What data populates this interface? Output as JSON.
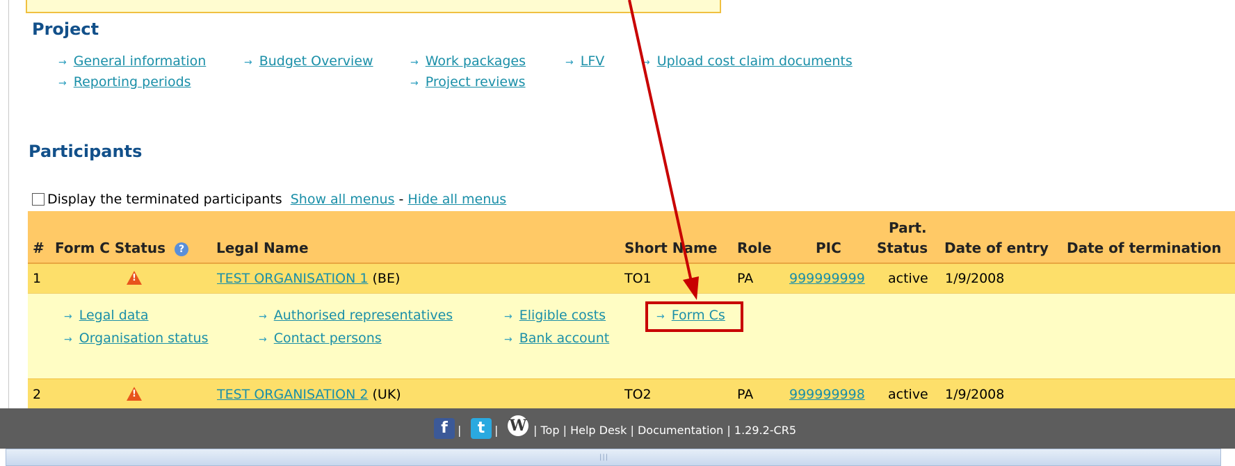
{
  "project": {
    "title": "Project",
    "links": [
      "General information",
      "Budget Overview",
      "Work packages",
      "LFV",
      "Upload cost claim documents",
      "Reporting periods",
      "Project reviews"
    ]
  },
  "participants": {
    "title": "Participants",
    "checkbox_label": "Display the terminated participants",
    "show_all": "Show all menus",
    "separator": "-",
    "hide_all": "Hide all menus",
    "headers": {
      "num": "#",
      "form_c_status": "Form C Status",
      "legal_name": "Legal Name",
      "short_name": "Short Name",
      "role": "Role",
      "pic": "PIC",
      "part": "Part.",
      "status": "Status",
      "date_entry": "Date of entry",
      "date_term": "Date of termination"
    },
    "rows": [
      {
        "num": "1",
        "legal_name": "TEST ORGANISATION 1",
        "country": "(BE)",
        "short_name": "TO1",
        "role": "PA",
        "pic": "999999999",
        "status": "active",
        "date_entry": "1/9/2008"
      },
      {
        "num": "2",
        "legal_name": "TEST ORGANISATION 2",
        "country": "(UK)",
        "short_name": "TO2",
        "role": "PA",
        "pic": "999999998",
        "status": "active",
        "date_entry": "1/9/2008"
      }
    ],
    "submenu": [
      "Legal data",
      "Authorised representatives",
      "Eligible costs",
      "Form Cs",
      "Organisation status",
      "Contact persons",
      "Bank account"
    ]
  },
  "footer": {
    "top": "Top",
    "help": "Help Desk",
    "docs": "Documentation",
    "version": "1.29.2-CR5",
    "sep": "|"
  },
  "colors": {
    "header_bg": "#ffc966",
    "row_bg": "#fddf6a",
    "submenu_bg": "#fffdc4",
    "highlight": "#c80000",
    "footer_bg": "#5d5d5d"
  }
}
